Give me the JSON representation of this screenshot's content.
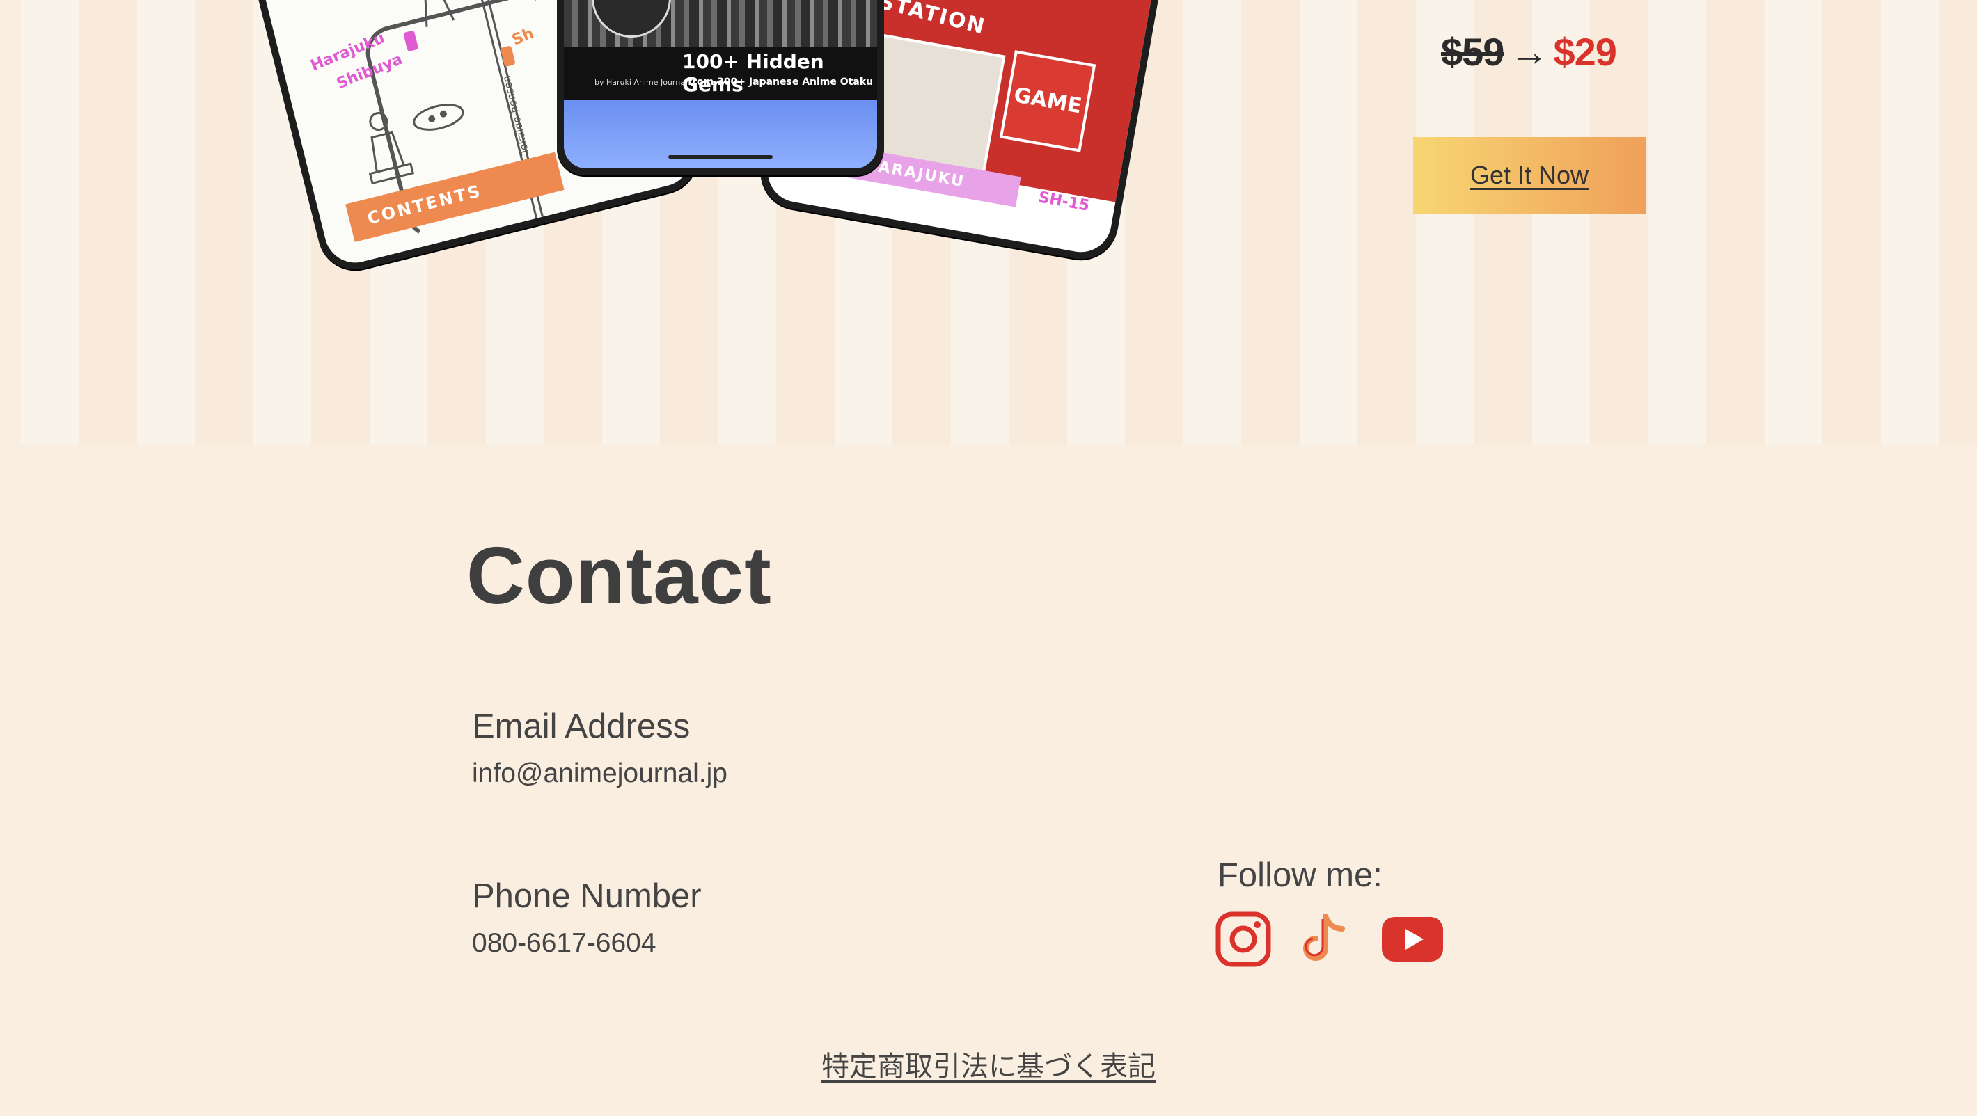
{
  "hero": {
    "phone_left": {
      "stations": [
        "Harajuku",
        "Shibuya",
        "Sh"
      ],
      "line_label": "Tokaido-honsen",
      "banner": "CONTENTS"
    },
    "phone_mid": {
      "title": "100+ Hidden Gems",
      "subtitle": "from 300+ Japanese Anime Otaku",
      "byline": "by Haruki Anime Journal"
    },
    "phone_right": {
      "sign": "ITO STATION",
      "game_sign": "GAME",
      "banner": "A & HARAJUKU",
      "code": "SH-15"
    }
  },
  "pricing": {
    "old_price": "$59",
    "arrow": "→",
    "new_price": "$29",
    "cta_label": "Get It Now"
  },
  "contact": {
    "title": "Contact",
    "email_label": "Email Address",
    "email_value": "info@animejournal.jp",
    "phone_label": "Phone Number",
    "phone_value": "080-6617-6604",
    "follow_label": "Follow me:",
    "socials": [
      "instagram-icon",
      "tiktok-icon",
      "youtube-icon"
    ]
  },
  "footer": {
    "legal_link": "特定商取引法に基づく表記"
  },
  "colors": {
    "background": "#faeee0",
    "price_red": "#d9332b",
    "cta_gradient_start": "#f7d672",
    "cta_gradient_end": "#f0a05a",
    "social_red": "#d9332b"
  }
}
